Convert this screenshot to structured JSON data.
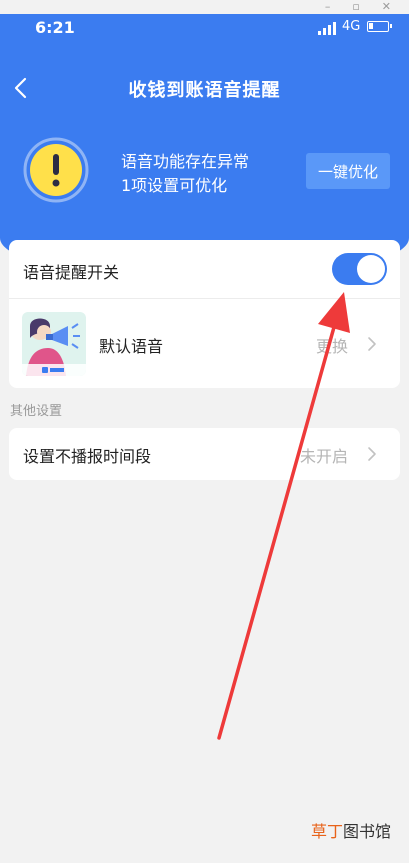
{
  "status_bar": {
    "time": "6:21",
    "network": "4G"
  },
  "header": {
    "title": "收钱到账语音提醒"
  },
  "alert": {
    "line1": "语音功能存在异常",
    "line2": "1项设置可优化",
    "button_label": "一键优化"
  },
  "settings": {
    "voice_switch": {
      "label": "语音提醒开关",
      "on": true
    },
    "default_voice": {
      "label": "默认语音",
      "action": "更换"
    }
  },
  "other": {
    "section_label": "其他设置",
    "no_broadcast": {
      "label": "设置不播报时间段",
      "status": "未开启"
    }
  },
  "watermark": {
    "part1": "草丁",
    "part2": "图书馆"
  },
  "colors": {
    "primary": "#3b7cf0",
    "button": "#5a98f8",
    "annotation_arrow": "#ee3a3a",
    "alert_yellow": "#ffe04a"
  }
}
